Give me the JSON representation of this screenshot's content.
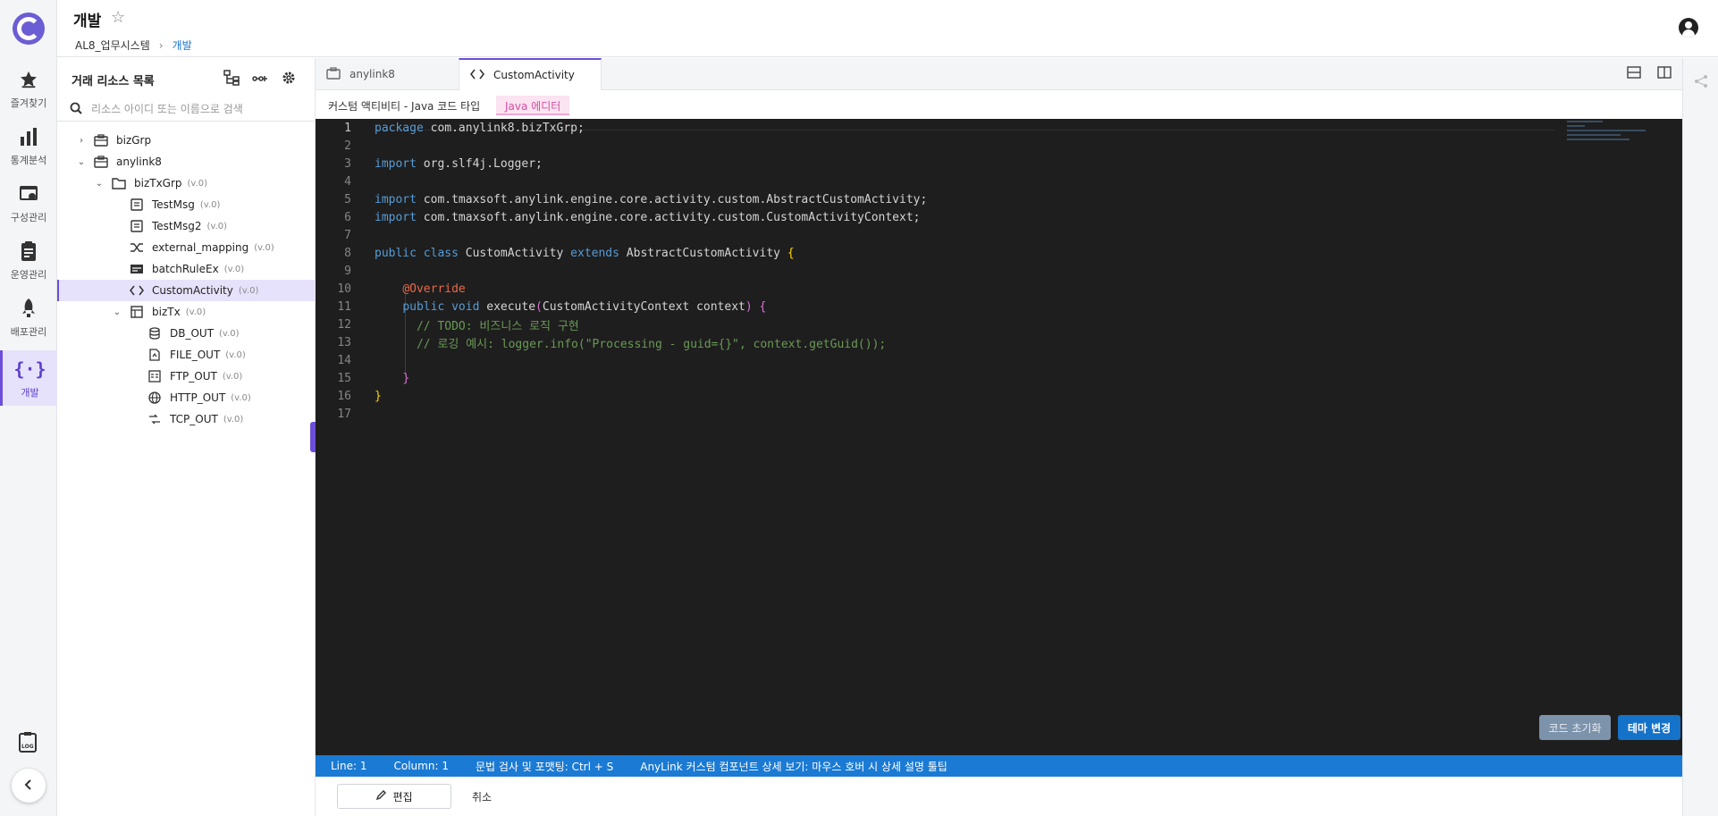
{
  "header": {
    "title": "개발",
    "breadcrumb": [
      "AL8_업무시스템",
      "개발"
    ]
  },
  "rail": {
    "items": [
      {
        "label": "즐겨찾기",
        "icon": "star-icon"
      },
      {
        "label": "통계분석",
        "icon": "chart-icon"
      },
      {
        "label": "구성관리",
        "icon": "config-icon"
      },
      {
        "label": "운영관리",
        "icon": "clipboard-icon"
      },
      {
        "label": "배포관리",
        "icon": "rocket-icon"
      },
      {
        "label": "개발",
        "icon": "code-braces-icon"
      }
    ],
    "active": "개발"
  },
  "panel": {
    "title": "거래 리소스 목록",
    "search_placeholder": "리소스 아이디 또는 이름으로 검색",
    "tree": [
      {
        "label": "bizGrp",
        "ver": "",
        "icon": "briefcase-icon",
        "depth": 0,
        "chevron": "›"
      },
      {
        "label": "anylink8",
        "ver": "",
        "icon": "briefcase-icon",
        "depth": 0,
        "chevron": "⌄"
      },
      {
        "label": "bizTxGrp",
        "ver": "(v.0)",
        "icon": "folder-icon",
        "depth": 1,
        "chevron": "⌄"
      },
      {
        "label": "TestMsg",
        "ver": "(v.0)",
        "icon": "message-icon",
        "depth": 2,
        "chevron": ""
      },
      {
        "label": "TestMsg2",
        "ver": "(v.0)",
        "icon": "message-icon",
        "depth": 2,
        "chevron": ""
      },
      {
        "label": "external_mapping",
        "ver": "(v.0)",
        "icon": "mapping-icon",
        "depth": 2,
        "chevron": ""
      },
      {
        "label": "batchRuleEx",
        "ver": "(v.0)",
        "icon": "batch-icon",
        "depth": 2,
        "chevron": ""
      },
      {
        "label": "CustomActivity",
        "ver": "(v.0)",
        "icon": "code-icon",
        "depth": 2,
        "chevron": "",
        "selected": true
      },
      {
        "label": "bizTx",
        "ver": "(v.0)",
        "icon": "table-icon",
        "depth": 2,
        "chevron": "⌄"
      },
      {
        "label": "DB_OUT",
        "ver": "(v.0)",
        "icon": "database-icon",
        "depth": 3,
        "chevron": ""
      },
      {
        "label": "FILE_OUT",
        "ver": "(v.0)",
        "icon": "file-icon",
        "depth": 3,
        "chevron": ""
      },
      {
        "label": "FTP_OUT",
        "ver": "(v.0)",
        "icon": "ftp-icon",
        "depth": 3,
        "chevron": ""
      },
      {
        "label": "HTTP_OUT",
        "ver": "(v.0)",
        "icon": "globe-icon",
        "depth": 3,
        "chevron": ""
      },
      {
        "label": "TCP_OUT",
        "ver": "(v.0)",
        "icon": "tcp-icon",
        "depth": 3,
        "chevron": ""
      }
    ]
  },
  "tabs": [
    {
      "label": "anylink8",
      "icon": "briefcase-icon",
      "active": false
    },
    {
      "label": "CustomActivity",
      "icon": "code-icon",
      "active": true
    }
  ],
  "subtabs": {
    "first": "커스텀 액티비티 - Java 코드 타입",
    "second": "Java 에디터"
  },
  "code": [
    "package com.anylink8.bizTxGrp;",
    "",
    "import org.slf4j.Logger;",
    "",
    "import com.tmaxsoft.anylink.engine.core.activity.custom.AbstractCustomActivity;",
    "import com.tmaxsoft.anylink.engine.core.activity.custom.CustomActivityContext;",
    "",
    "public class CustomActivity extends AbstractCustomActivity {",
    "",
    "    @Override",
    "    public void execute(CustomActivityContext context) {",
    "      // TODO: 비즈니스 로직 구현",
    "      // 로깅 예시: logger.info(\"Processing - guid={}\", context.getGuid());",
    "",
    "    }",
    "}",
    ""
  ],
  "editor_buttons": {
    "reset": "코드 초기화",
    "theme": "테마 변경"
  },
  "status": {
    "line": "Line: 1",
    "column": "Column: 1",
    "hint1": "문법 검사 및 포맷팅: Ctrl + S",
    "hint2": "AnyLink 커스텀 컴포넌트 상세 보기: 마우스 호버 시 상세 설명 툴팁"
  },
  "footer": {
    "edit": "편집",
    "cancel": "취소"
  },
  "colors": {
    "accent": "#6b4fd8",
    "status_bar": "#1a7ad4",
    "editor_bg": "#1e1e1e",
    "keyword": "#569cd6",
    "comment": "#6a9955"
  }
}
